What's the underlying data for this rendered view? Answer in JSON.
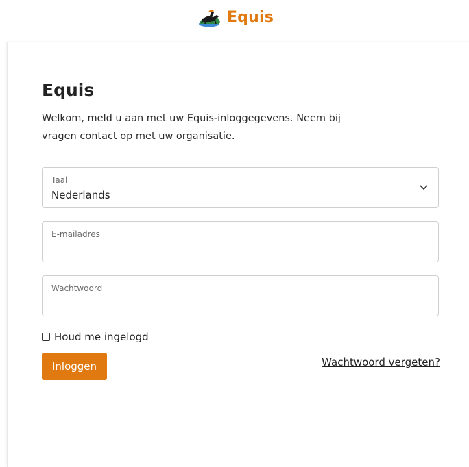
{
  "header": {
    "brand_name": "Equis",
    "brand_color": "#e07a10",
    "logo_icon": "horse-rider-logo"
  },
  "login": {
    "title": "Equis",
    "intro": "Welkom, meld u aan met uw Equis-inloggegevens. Neem bij vragen contact op met uw organisatie.",
    "language": {
      "label": "Taal",
      "value": "Nederlands",
      "icon": "chevron-down-icon"
    },
    "email": {
      "label": "E-mailadres",
      "value": ""
    },
    "password": {
      "label": "Wachtwoord",
      "value": ""
    },
    "remember_label": "Houd me ingelogd",
    "remember_checked": false,
    "login_button": "Inloggen",
    "forgot_link": "Wachtwoord vergeten?"
  },
  "colors": {
    "accent": "#e07a10",
    "border": "#cfcfcf",
    "text": "#222222",
    "muted": "#6b6b6b"
  }
}
